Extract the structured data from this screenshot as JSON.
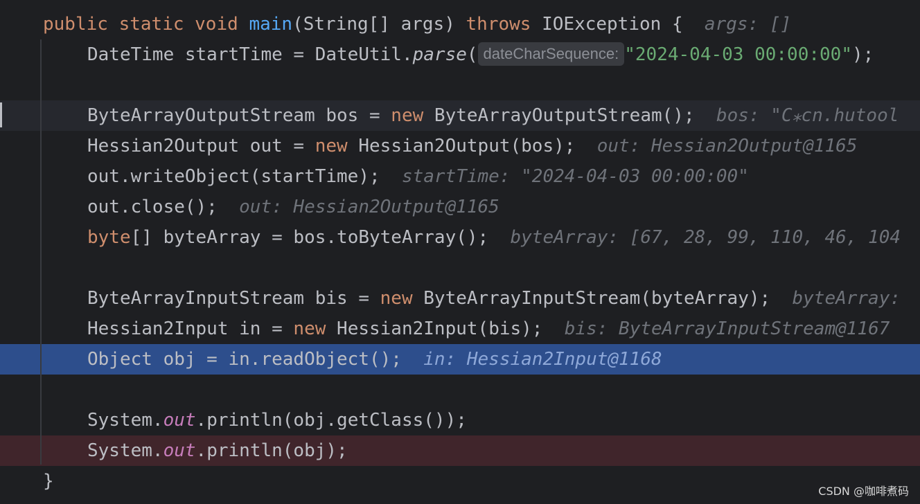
{
  "editor": {
    "line1": {
      "kw_public": "public",
      "kw_static": "static",
      "kw_void": "void",
      "fn_main": "main",
      "params": "(String[] args)",
      "kw_throws": "throws",
      "rest": "IOException {",
      "hint": "args: []"
    },
    "line2": {
      "pre": "DateTime startTime = DateUtil.",
      "method": "parse",
      "paren": "(",
      "inlay": "dateCharSequence:",
      "string": "\"2024-04-03 00:00:00\"",
      "post": ");"
    },
    "line4": {
      "pre": "ByteArrayOutputStream bos = ",
      "kw_new": "new",
      "post": " ByteArrayOutputStream();",
      "hint": "bos: \"C⁎cn.hutool"
    },
    "line5": {
      "pre": "Hessian2Output out = ",
      "kw_new": "new",
      "post": " Hessian2Output(bos);",
      "hint": "out: Hessian2Output@1165"
    },
    "line6": {
      "code": "out.writeObject(startTime);",
      "hint": "startTime: \"2024-04-03 00:00:00\""
    },
    "line7": {
      "code": "out.close();",
      "hint": "out: Hessian2Output@1165"
    },
    "line8": {
      "kw_byte": "byte",
      "post": "[] byteArray = bos.toByteArray();",
      "hint": "byteArray: [67, 28, 99, 110, 46, 104"
    },
    "line10": {
      "pre": "ByteArrayInputStream bis = ",
      "kw_new": "new",
      "post": " ByteArrayInputStream(byteArray);",
      "hint": "byteArray:"
    },
    "line11": {
      "pre": "Hessian2Input in = ",
      "kw_new": "new",
      "post": " Hessian2Input(bis);",
      "hint": "bis: ByteArrayInputStream@1167"
    },
    "line12": {
      "code": "Object obj = in.readObject();",
      "hint": "in: Hessian2Input@1168"
    },
    "line14": {
      "pre": "System.",
      "field": "out",
      "post": ".println(obj.getClass());"
    },
    "line15": {
      "pre": "System.",
      "field": "out",
      "post": ".println(obj);"
    },
    "line16": {
      "brace": "}"
    }
  },
  "watermark": "CSDN @咖啡煮码",
  "colors": {
    "background": "#1e1f22",
    "keyword": "#cf8e6d",
    "function": "#56a8f5",
    "string": "#6aab73",
    "static_field": "#c77dbb",
    "debug_line": "#2d4e8c",
    "breakpoint_line": "#40252b"
  }
}
